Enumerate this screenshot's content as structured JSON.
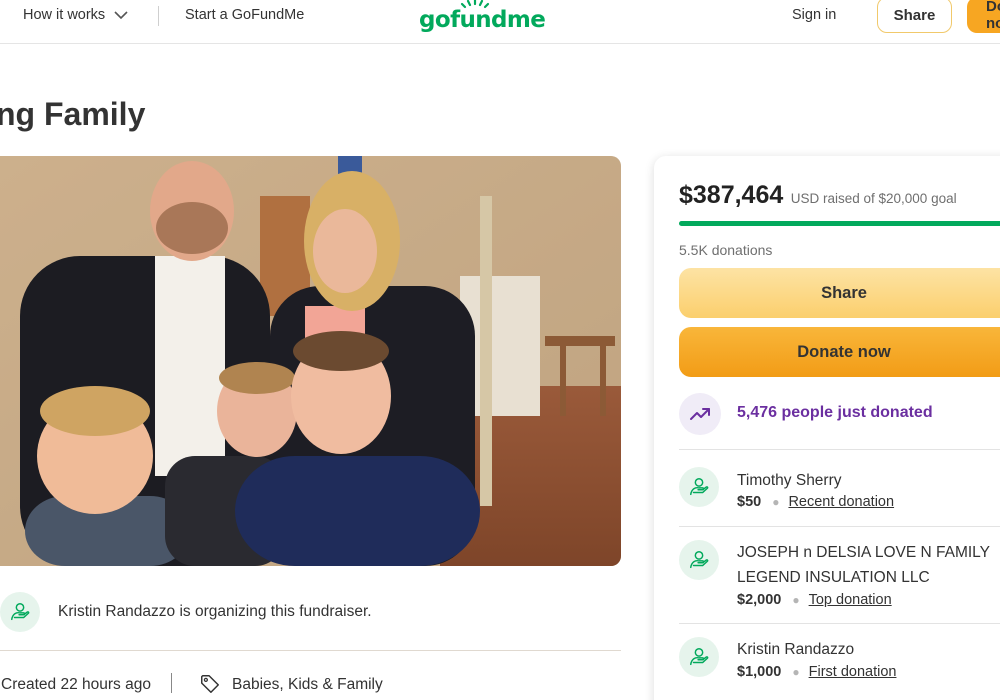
{
  "header": {
    "how_it_works": "How it works",
    "start": "Start a GoFundMe",
    "logo": "gofundme",
    "sign_in": "Sign in",
    "share": "Share",
    "donate": "Donate now"
  },
  "page": {
    "title": "ng Family"
  },
  "organizer": {
    "text": "Kristin Randazzo is organizing this fundraiser."
  },
  "meta": {
    "created": "Created 22 hours ago",
    "category": "Babies, Kids & Family"
  },
  "campaign": {
    "raised": "$387,464",
    "raised_sub": "USD raised of $20,000 goal",
    "progress_fraction": 1.0,
    "donations_count": "5.5K donations",
    "share_label": "Share",
    "donate_label": "Donate now",
    "trend_text": "5,476 people just donated"
  },
  "donations": [
    {
      "name": "Timothy Sherry",
      "amount": "$50",
      "label": "Recent donation"
    },
    {
      "name": "JOSEPH n DELSIA LOVE N FAMILY LEGEND INSULATION LLC",
      "amount": "$2,000",
      "label": "Top donation"
    },
    {
      "name": "Kristin Randazzo",
      "amount": "$1,000",
      "label": "First donation"
    }
  ],
  "colors": {
    "brand_green": "#02a95c",
    "donate_orange": "#f29c16",
    "share_yellow": "#fbcf6d",
    "trend_purple": "#6b2fa0"
  },
  "icons": {
    "how_it_works": "chevron-down-icon",
    "organizer": "heart-hand-icon",
    "category": "tag-icon",
    "trend": "trending-up-icon",
    "donor": "heart-hand-icon"
  }
}
